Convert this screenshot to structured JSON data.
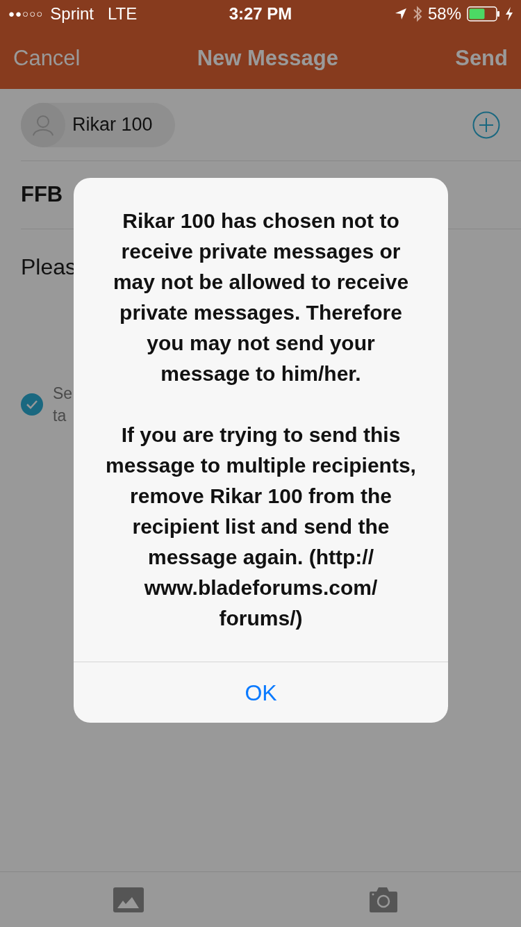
{
  "status_bar": {
    "signal_dots": "●●○○○",
    "carrier": "Sprint",
    "network": "LTE",
    "time": "3:27 PM",
    "battery": "58%"
  },
  "nav": {
    "cancel": "Cancel",
    "title": "New Message",
    "send": "Send"
  },
  "recipient": {
    "name": "Rikar 100"
  },
  "subject": "FFB",
  "body": "Pleas",
  "option": {
    "checked": true,
    "lines": [
      "Se",
      "ta"
    ]
  },
  "alert": {
    "paragraphs": [
      "Rikar 100 has chosen not to receive private messages or may not be allowed to receive private messages. Therefore you may not send your message to him/her.",
      "If you are trying to send this message to multiple recipients, remove Rikar 100 from the recipient list and send the message again. (http:// www.bladeforums.com/ forums/)"
    ],
    "button": "OK"
  }
}
